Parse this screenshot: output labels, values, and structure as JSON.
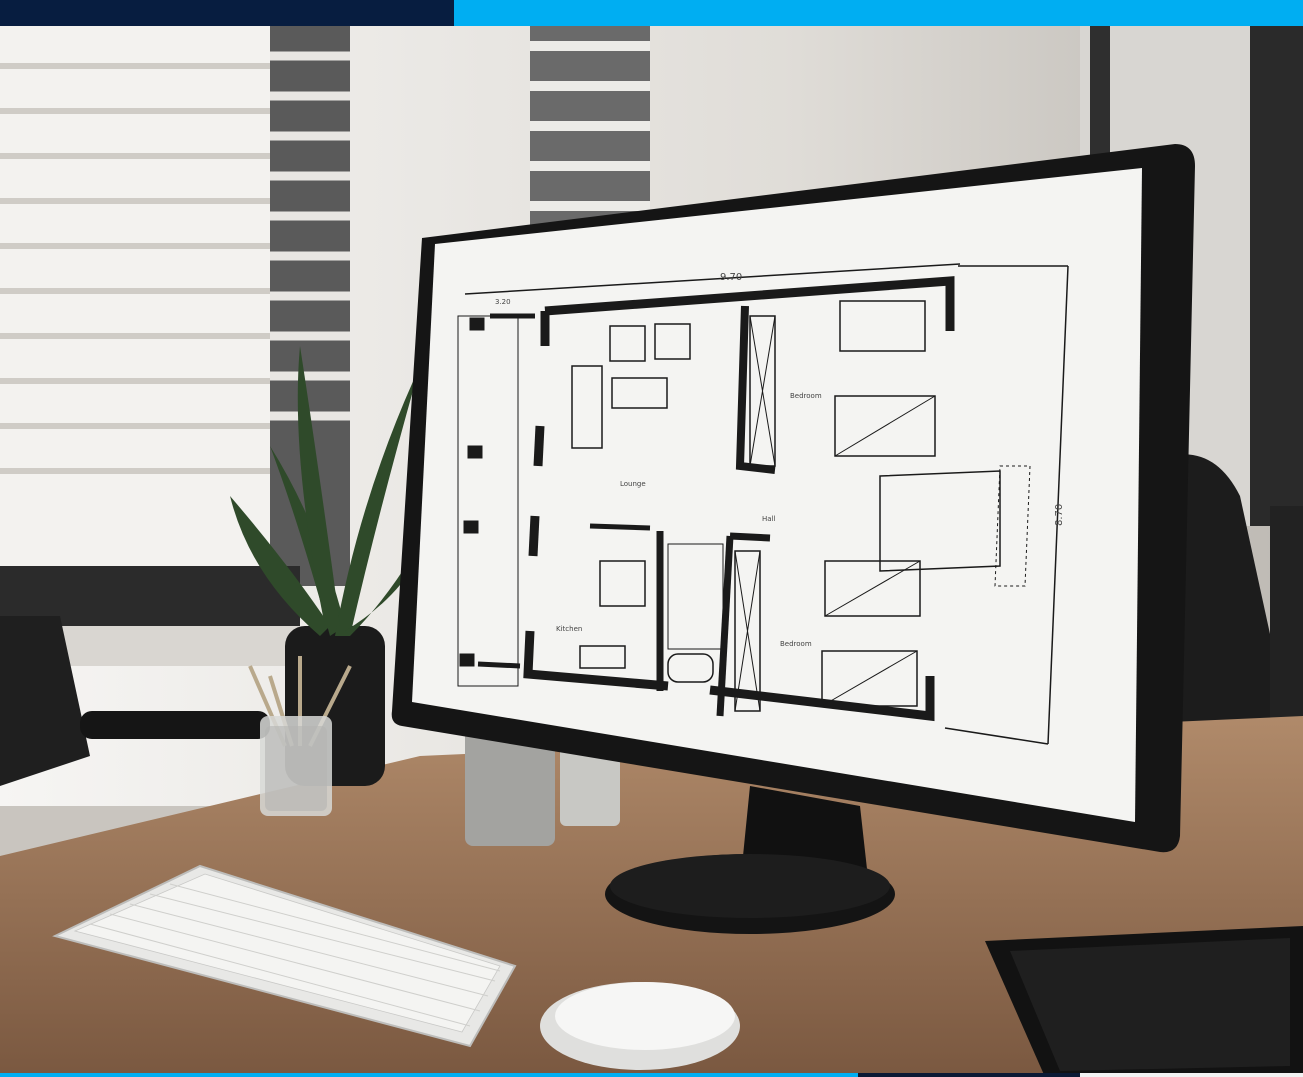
{
  "colors": {
    "top_dark": "#071d40",
    "top_light": "#00aef2",
    "bottom_a": "#00aef2",
    "bottom_b": "#0b1a35",
    "bottom_c": "#f2f2f2",
    "desk": "#9a7456",
    "monitor": "#151515",
    "screen": "#f4f4f2",
    "wall": "#e6e4e0"
  },
  "floorplan": {
    "dim_top": "9.70",
    "dim_left": "3.20",
    "dim_right": "8.70",
    "rooms": {
      "lounge": "Lounge",
      "bedroom_top": "Bedroom",
      "hall": "Hall",
      "kitchen": "Kitchen",
      "bedroom_bottom": "Bedroom"
    }
  },
  "icons": {
    "plant": "plant-icon",
    "pencil_cup": "pencil-cup-icon",
    "keyboard": "keyboard-icon",
    "mouse": "mouse-icon",
    "tablet": "tablet-icon"
  }
}
